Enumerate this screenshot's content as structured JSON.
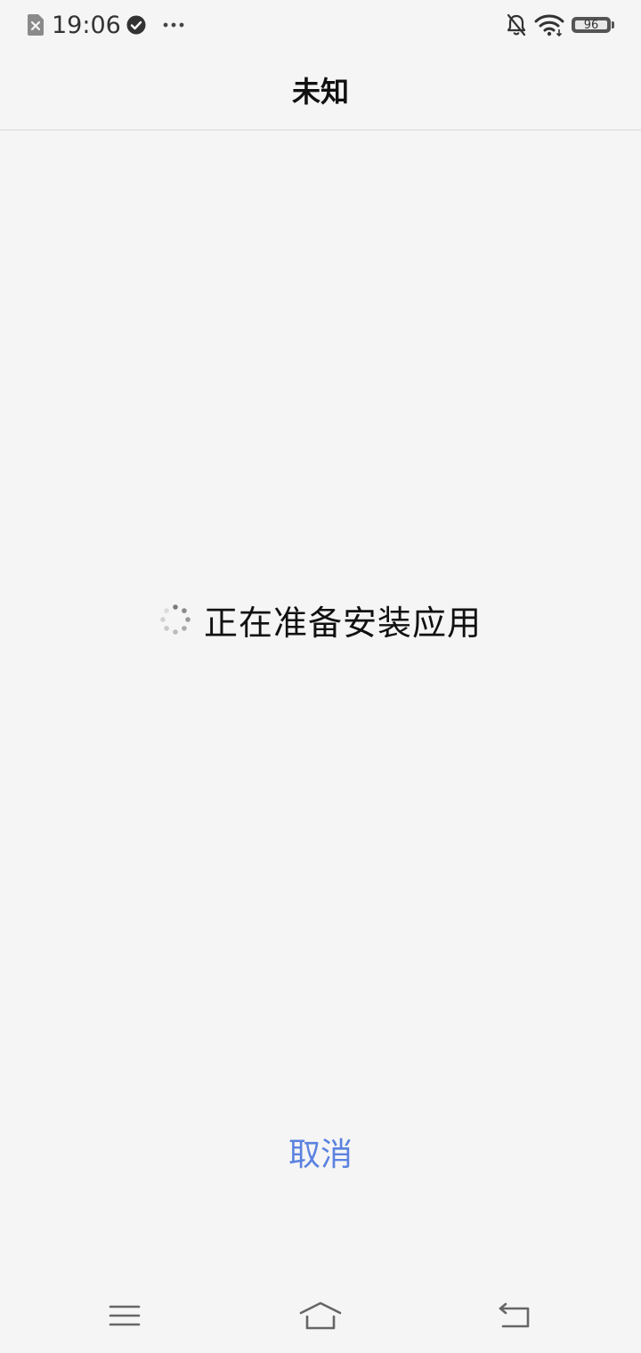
{
  "status_bar": {
    "time": "19:06",
    "battery_level": "96",
    "icons": [
      "sim-error-icon",
      "check-circle-icon",
      "more-dots-icon",
      "bell-off-icon",
      "wifi-icon",
      "battery-icon"
    ]
  },
  "header": {
    "title": "未知"
  },
  "main": {
    "loading_text": "正在准备安装应用",
    "spinner_icon": "loading-spinner-icon"
  },
  "actions": {
    "cancel_label": "取消",
    "accent_color": "#5b82e0"
  },
  "nav_bar": {
    "icons": [
      "menu-icon",
      "home-icon",
      "back-icon"
    ]
  }
}
